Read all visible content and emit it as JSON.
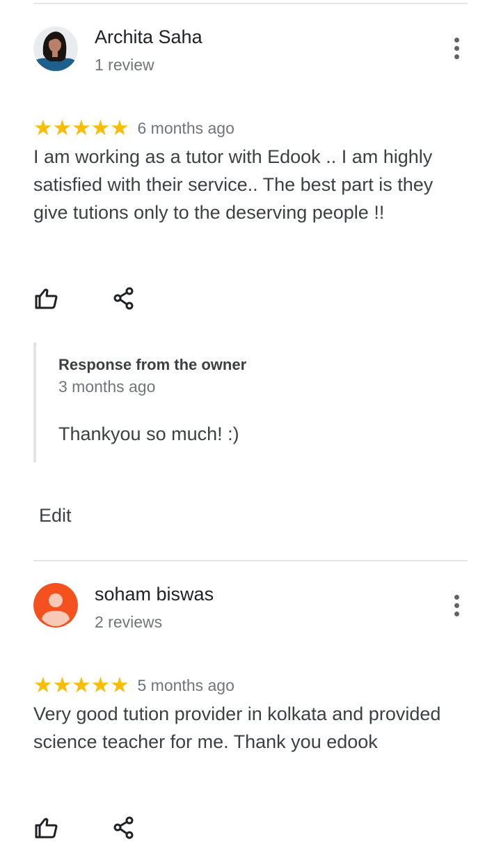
{
  "reviews": [
    {
      "author": "Archita Saha",
      "review_count": "1 review",
      "avatar": "photo-avatar",
      "rating": 5,
      "time": "6 months ago",
      "text": "I am working as a tutor with Edook .. I am highly satisfied with their service.. The best part is they give tutions only to the deserving people !!",
      "owner_response": {
        "title": "Response from the owner",
        "time": "3 months ago",
        "text": "Thankyou so much! :)"
      },
      "edit_label": "Edit"
    },
    {
      "author": "soham biswas",
      "review_count": "2 reviews",
      "avatar": "default-person-avatar",
      "rating": 5,
      "time": "5 months ago",
      "text": "Very good tution provider in kolkata and provided science teacher for me. Thank you edook"
    }
  ],
  "icons": {
    "like": "thumbs-up-icon",
    "share": "share-icon",
    "more": "more-vert-icon",
    "star": "star-icon"
  },
  "colors": {
    "star": "#fbbc04",
    "avatar_bg": "#f4511e",
    "divider": "#e3e3e3"
  }
}
